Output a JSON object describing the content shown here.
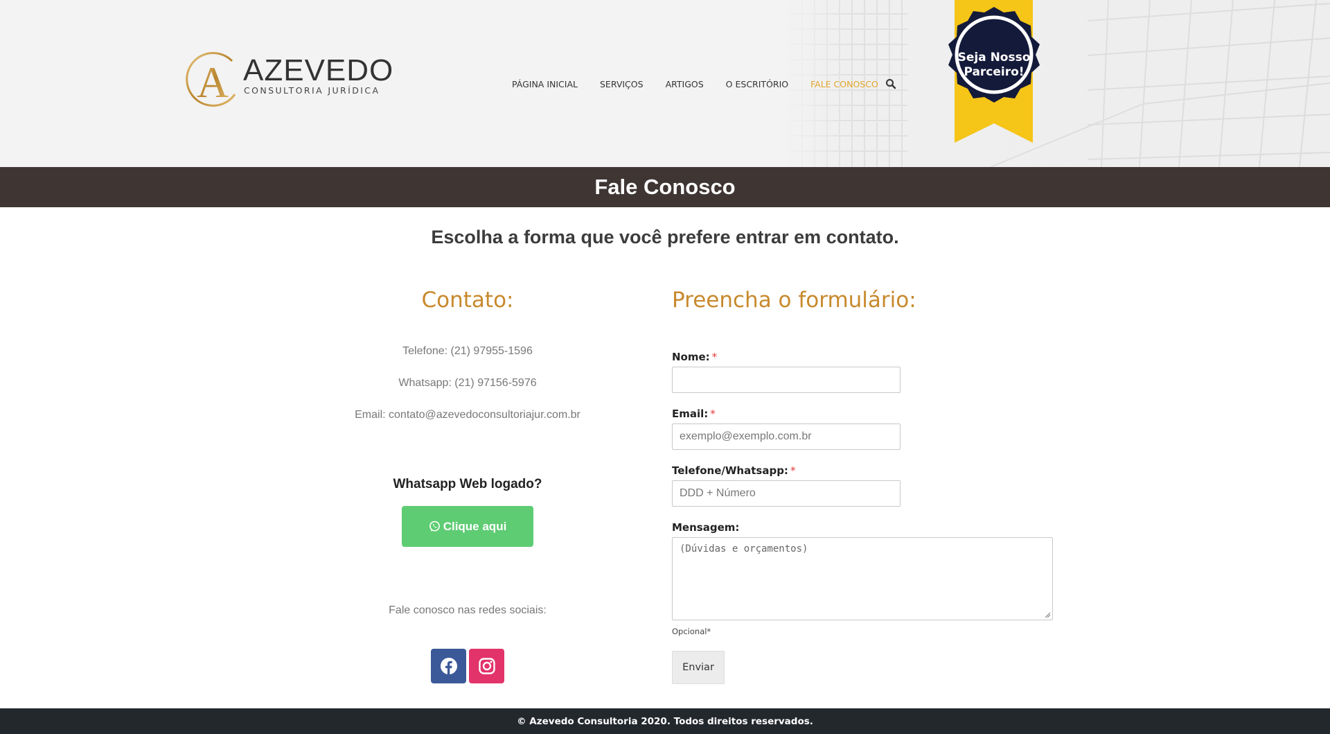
{
  "brand": {
    "name": "AZEVEDO",
    "tagline": "CONSULTORIA JURÍDICA",
    "logo_letter": "A",
    "gold": "#c8892d"
  },
  "nav": {
    "items": [
      {
        "label": "PÁGINA INICIAL",
        "active": false
      },
      {
        "label": "SERVIÇOS",
        "active": false
      },
      {
        "label": "ARTIGOS",
        "active": false
      },
      {
        "label": "O ESCRITÓRIO",
        "active": false
      },
      {
        "label": "FALE CONOSCO",
        "active": true
      }
    ],
    "search_icon": "search-icon",
    "active_color": "#e3a52a"
  },
  "badge": {
    "line1": "Seja Nosso",
    "line2": "Parceiro!",
    "ribbon_color": "#f5c518",
    "seal_color": "#141a3a"
  },
  "page": {
    "title": "Fale Conosco",
    "subtitle": "Escolha a forma que você prefere entrar em contato."
  },
  "contact": {
    "heading": "Contato:",
    "phone": "Telefone: (21) 97955-1596",
    "whatsapp": "Whatsapp: (21) 97156-5976",
    "email": "Email: contato@azevedoconsultoriajur.com.br",
    "wa_question": "Whatsapp Web logado?",
    "wa_button": "Clique aqui",
    "wa_color": "#5ecc73",
    "social_label": "Fale conosco nas redes sociais:",
    "social": [
      {
        "icon": "facebook-icon",
        "color": "#3b5998"
      },
      {
        "icon": "instagram-icon",
        "color": "#e2336b"
      }
    ]
  },
  "form": {
    "heading": "Preencha o formulário:",
    "required_mark": "*",
    "name_label": "Nome:",
    "name_value": "",
    "email_label": "Email:",
    "email_placeholder": "exemplo@exemplo.com.br",
    "phone_label": "Telefone/Whatsapp:",
    "phone_placeholder": "DDD + Número",
    "message_label": "Mensagem:",
    "message_placeholder": "(Dúvidas e orçamentos)",
    "hint": "Opcional*",
    "submit": "Enviar"
  },
  "footer": {
    "text": "© Azevedo Consultoria 2020. Todos direitos reservados."
  }
}
